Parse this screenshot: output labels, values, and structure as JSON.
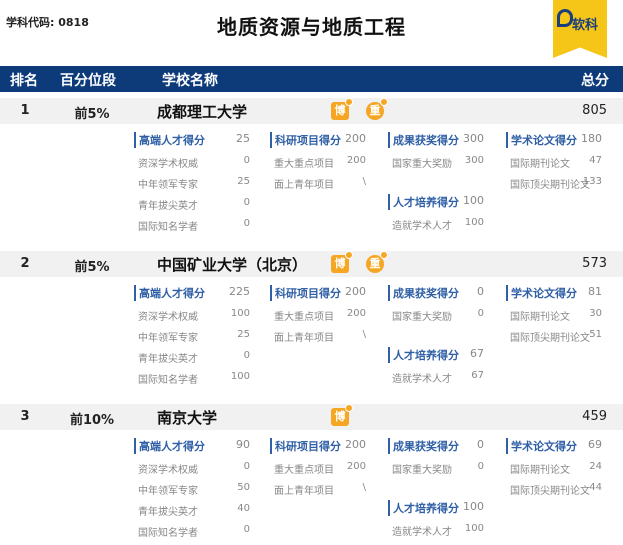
{
  "header": {
    "code": "学科代码: 0818",
    "title": "地质资源与地质工程",
    "logo_text": "软科"
  },
  "columns": {
    "rank": "排名",
    "percentile": "百分位段",
    "school": "学校名称",
    "total": "总分"
  },
  "colors": {
    "header_bg": "#0d3b7a",
    "accent": "#2f5fa5",
    "badge": "#f5a623",
    "logo": "#f5c518"
  },
  "rows": [
    {
      "rank": "1",
      "pct": "前5%",
      "name": "成都理工大学",
      "score": "805",
      "badges": [
        "博",
        "重"
      ],
      "talent": {
        "label": "高端人才得分",
        "value": "25",
        "items": [
          [
            "资深学术权威",
            "0"
          ],
          [
            "中年领军专家",
            "25"
          ],
          [
            "青年拔尖英才",
            "0"
          ],
          [
            "国际知名学者",
            "0"
          ]
        ]
      },
      "research": {
        "label": "科研项目得分",
        "value": "200",
        "items": [
          [
            "重大重点项目",
            "200"
          ],
          [
            "面上青年项目",
            "\\"
          ]
        ]
      },
      "award": {
        "label": "成果获奖得分",
        "value": "300",
        "items": [
          [
            "国家重大奖励",
            "300"
          ]
        ]
      },
      "training": {
        "label": "人才培养得分",
        "value": "100",
        "items": [
          [
            "造就学术人才",
            "100"
          ]
        ]
      },
      "paper": {
        "label": "学术论文得分",
        "value": "180",
        "items": [
          [
            "国际期刊论文",
            "47"
          ],
          [
            "国际顶尖期刊论文",
            "133"
          ]
        ]
      }
    },
    {
      "rank": "2",
      "pct": "前5%",
      "name": "中国矿业大学（北京）",
      "score": "573",
      "badges": [
        "博",
        "重"
      ],
      "talent": {
        "label": "高端人才得分",
        "value": "225",
        "items": [
          [
            "资深学术权威",
            "100"
          ],
          [
            "中年领军专家",
            "25"
          ],
          [
            "青年拔尖英才",
            "0"
          ],
          [
            "国际知名学者",
            "100"
          ]
        ]
      },
      "research": {
        "label": "科研项目得分",
        "value": "200",
        "items": [
          [
            "重大重点项目",
            "200"
          ],
          [
            "面上青年项目",
            "\\"
          ]
        ]
      },
      "award": {
        "label": "成果获奖得分",
        "value": "0",
        "items": [
          [
            "国家重大奖励",
            "0"
          ]
        ]
      },
      "training": {
        "label": "人才培养得分",
        "value": "67",
        "items": [
          [
            "造就学术人才",
            "67"
          ]
        ]
      },
      "paper": {
        "label": "学术论文得分",
        "value": "81",
        "items": [
          [
            "国际期刊论文",
            "30"
          ],
          [
            "国际顶尖期刊论文",
            "51"
          ]
        ]
      }
    },
    {
      "rank": "3",
      "pct": "前10%",
      "name": "南京大学",
      "score": "459",
      "badges": [
        "博"
      ],
      "talent": {
        "label": "高端人才得分",
        "value": "90",
        "items": [
          [
            "资深学术权威",
            "0"
          ],
          [
            "中年领军专家",
            "50"
          ],
          [
            "青年拔尖英才",
            "40"
          ],
          [
            "国际知名学者",
            "0"
          ]
        ]
      },
      "research": {
        "label": "科研项目得分",
        "value": "200",
        "items": [
          [
            "重大重点项目",
            "200"
          ],
          [
            "面上青年项目",
            "\\"
          ]
        ]
      },
      "award": {
        "label": "成果获奖得分",
        "value": "0",
        "items": [
          [
            "国家重大奖励",
            "0"
          ]
        ]
      },
      "training": {
        "label": "人才培养得分",
        "value": "100",
        "items": [
          [
            "造就学术人才",
            "100"
          ]
        ]
      },
      "paper": {
        "label": "学术论文得分",
        "value": "69",
        "items": [
          [
            "国际期刊论文",
            "24"
          ],
          [
            "国际顶尖期刊论文",
            "44"
          ]
        ]
      }
    }
  ]
}
